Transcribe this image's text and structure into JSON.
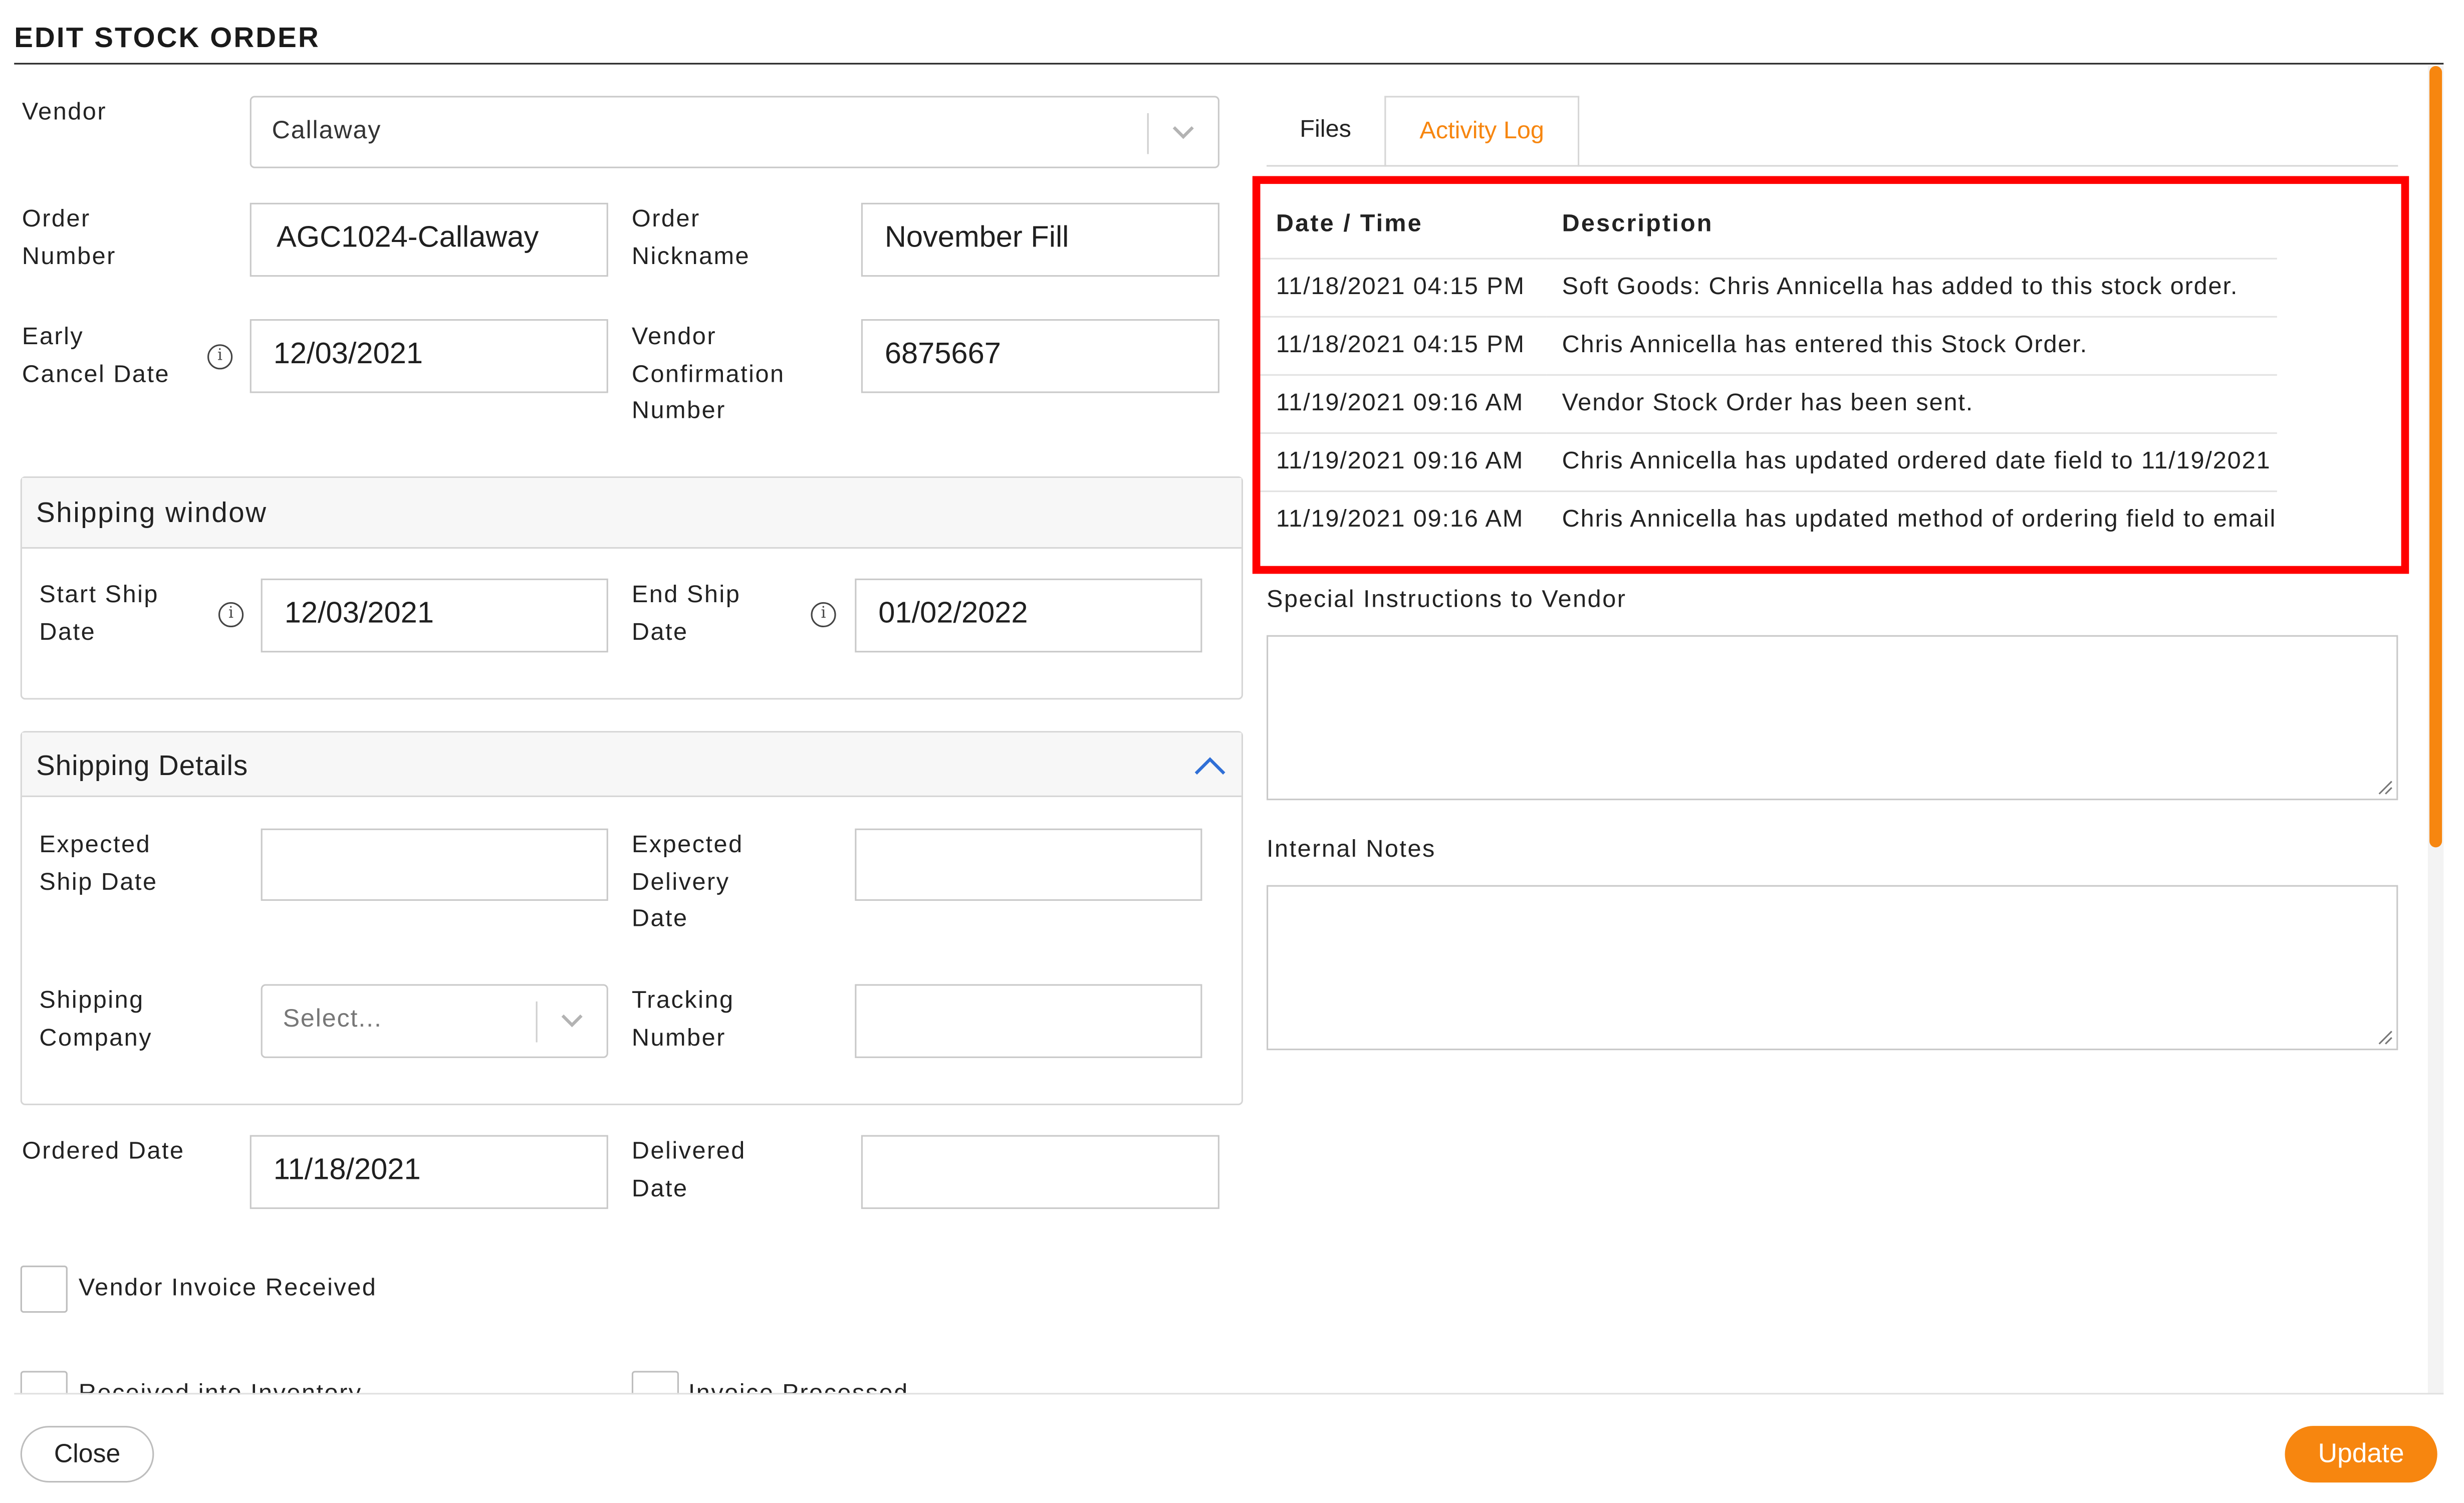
{
  "header": {
    "title": "EDIT STOCK ORDER"
  },
  "form": {
    "vendor": {
      "label": "Vendor",
      "value": "Callaway"
    },
    "order_number": {
      "label_line1": "Order",
      "label_line2": "Number",
      "value": "AGC1024-Callaway"
    },
    "order_nickname": {
      "label_line1": "Order",
      "label_line2": "Nickname",
      "value": "November Fill"
    },
    "early_cancel_date": {
      "label_line1": "Early",
      "label_line2": "Cancel Date",
      "value": "12/03/2021"
    },
    "vendor_confirmation": {
      "label_line1": "Vendor",
      "label_line2": "Confirmation",
      "label_line3": "Number",
      "value": "6875667"
    },
    "shipping_window": {
      "title": "Shipping window",
      "start_ship": {
        "label_line1": "Start Ship",
        "label_line2": "Date",
        "value": "12/03/2021"
      },
      "end_ship": {
        "label_line1": "End Ship",
        "label_line2": "Date",
        "value": "01/02/2022"
      }
    },
    "shipping_details": {
      "title": "Shipping Details",
      "expected_ship": {
        "label_line1": "Expected",
        "label_line2": "Ship Date",
        "value": ""
      },
      "expected_delivery": {
        "label_line1": "Expected",
        "label_line2": "Delivery",
        "label_line3": "Date",
        "value": ""
      },
      "shipping_company": {
        "label_line1": "Shipping",
        "label_line2": "Company",
        "placeholder": "Select..."
      },
      "tracking_number": {
        "label_line1": "Tracking",
        "label_line2": "Number",
        "value": ""
      }
    },
    "ordered_date": {
      "label": "Ordered Date",
      "value": "11/18/2021"
    },
    "delivered_date": {
      "label_line1": "Delivered",
      "label_line2": "Date",
      "value": ""
    },
    "vendor_invoice_received": {
      "label": "Vendor Invoice Received"
    },
    "received_into_inventory": {
      "label": "Received into Inventory"
    },
    "invoice_processed": {
      "label": "Invoice Processed"
    }
  },
  "tabs": [
    {
      "label": "Files"
    },
    {
      "label": "Activity Log"
    }
  ],
  "activity_log": {
    "columns": [
      "Date / Time",
      "Description"
    ],
    "rows": [
      [
        "11/18/2021 04:15 PM",
        "Soft Goods: Chris Annicella has added to this stock order."
      ],
      [
        "11/18/2021 04:15 PM",
        "Chris Annicella has entered this Stock Order."
      ],
      [
        "11/19/2021 09:16 AM",
        "Vendor Stock Order has been sent."
      ],
      [
        "11/19/2021 09:16 AM",
        "Chris Annicella has updated ordered date field to 11/19/2021"
      ],
      [
        "11/19/2021 09:16 AM",
        "Chris Annicella has updated method of ordering field to email"
      ]
    ]
  },
  "special_instructions": {
    "label": "Special Instructions to Vendor"
  },
  "internal_notes": {
    "label": "Internal Notes"
  },
  "footer": {
    "close_label": "Close",
    "update_label": "Update"
  },
  "colors": {
    "accent": "#f7860f",
    "highlight_border": "#ff0000",
    "link_blue": "#2f6fd6"
  }
}
